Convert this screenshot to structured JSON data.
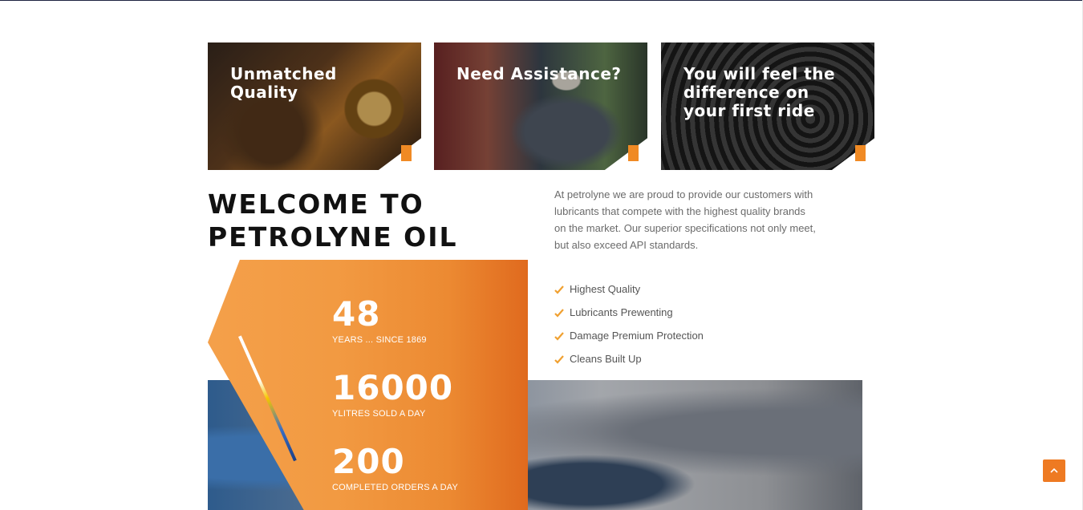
{
  "cards": [
    {
      "title": "Unmatched Quality"
    },
    {
      "title": "Need Assistance?"
    },
    {
      "title": "You will feel the difference on your first ride"
    }
  ],
  "welcome": {
    "line1": "WELCOME TO",
    "line2": "PETROLYNE OIL"
  },
  "intro": "At petrolyne we are proud to provide our customers with lubricants that compete with the highest quality brands on the market. Our superior specifications not only meet, but also exceed API standards.",
  "features": [
    "Highest Quality",
    "Lubricants Prewenting",
    "Damage Premium Protection",
    "Cleans Built Up"
  ],
  "stats": [
    {
      "value": "48",
      "label": "YEARS ... SINCE 1869"
    },
    {
      "value": "16000",
      "label": "YLITRES SOLD A DAY"
    },
    {
      "value": "200",
      "label": "COMPLETED ORDERS A DAY"
    }
  ],
  "colors": {
    "accent": "#f08a24",
    "dark": "#111111",
    "text_muted": "#6b6b6b"
  },
  "icons": {
    "feature": "check-icon",
    "scroll_top": "chevron-up-icon"
  }
}
